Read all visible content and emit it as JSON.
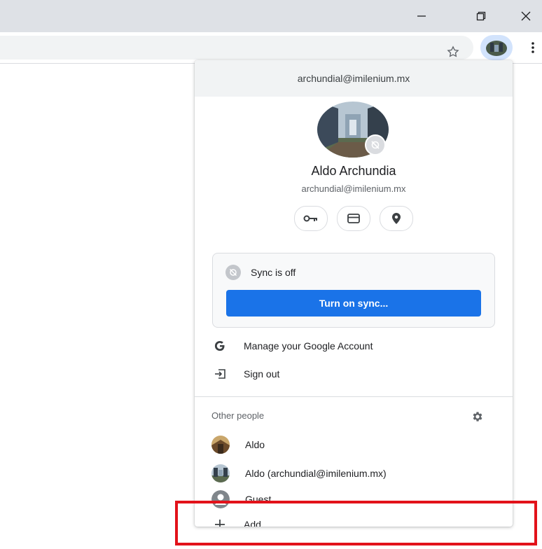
{
  "window": {
    "minimize_glyph": "—",
    "close_glyph": "✕"
  },
  "toolbar": {
    "star_icon": "star-icon",
    "menu_icon": "more-vert-icon"
  },
  "menu": {
    "header_email": "archundial@imilenium.mx",
    "profile": {
      "name": "Aldo Archundia",
      "email": "archundial@imilenium.mx"
    },
    "quick_actions": [
      "key-icon",
      "card-icon",
      "location-pin-icon"
    ],
    "sync": {
      "status": "Sync is off",
      "button_label": "Turn on sync..."
    },
    "manage_account": "Manage your Google Account",
    "sign_out": "Sign out",
    "other_people_label": "Other people",
    "people": [
      {
        "name": "Aldo"
      },
      {
        "name": "Aldo (archundial@imilenium.mx)"
      },
      {
        "name": "Guest"
      }
    ],
    "add_label": "Add"
  },
  "colors": {
    "accent": "#1a73e8",
    "highlight": "#e2121a",
    "chrome_bg": "#dee1e6"
  }
}
